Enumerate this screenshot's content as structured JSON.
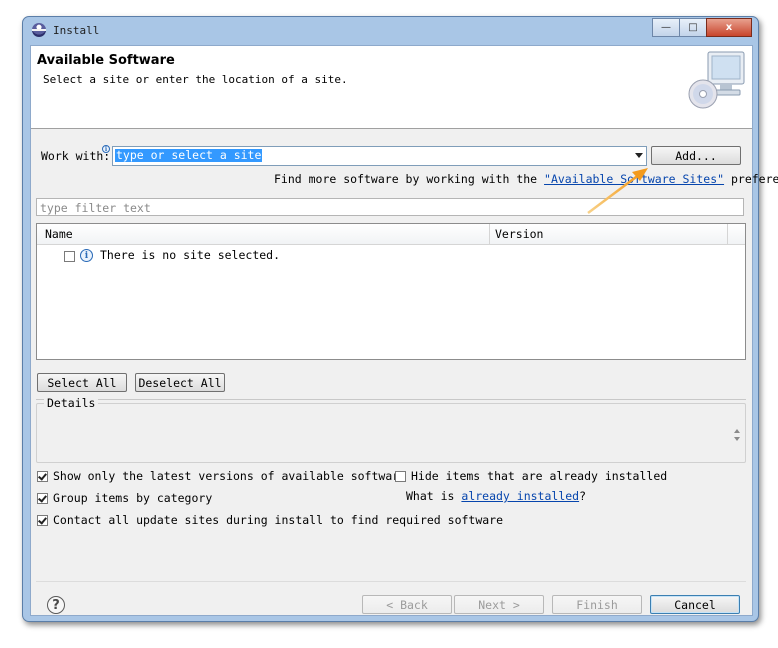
{
  "window": {
    "title": "Install",
    "caption_buttons": {
      "minimize": "—",
      "maximize": "□",
      "close": "x"
    }
  },
  "banner": {
    "title": "Available Software",
    "description": "Select a site or enter the location of a site."
  },
  "work_with": {
    "label": "Work with:",
    "value": "type or select a site",
    "add_button": "Add..."
  },
  "more_software": {
    "prefix": "Find more software by working with the ",
    "link": "\"Available Software Sites\"",
    "suffix": " preferences."
  },
  "filter": {
    "placeholder": "type filter text"
  },
  "table": {
    "columns": [
      "Name",
      "Version"
    ],
    "rows": [
      {
        "checked": false,
        "icon": "info-icon",
        "text": "There is no site selected."
      }
    ]
  },
  "selection_buttons": {
    "select_all": "Select All",
    "deselect_all": "Deselect All"
  },
  "details": {
    "label": "Details"
  },
  "options": {
    "latest_versions": {
      "label": "Show only the latest versions of available software",
      "checked": true
    },
    "group_by_category": {
      "label": "Group items by category",
      "checked": true
    },
    "contact_update_sites": {
      "label": "Contact all update sites during install to find required software",
      "checked": true
    },
    "hide_installed": {
      "label": "Hide items that are already installed",
      "checked": false
    },
    "what_is": {
      "prefix": "What is ",
      "link": "already installed",
      "suffix": "?"
    }
  },
  "footer": {
    "help_icon": "?",
    "back": "< Back",
    "next": "Next >",
    "finish": "Finish",
    "cancel": "Cancel"
  },
  "colors": {
    "window_frame": "#a9c6e6",
    "selection": "#3399ff",
    "link": "#0645ad",
    "annotation_arrow": "#f5a623"
  }
}
